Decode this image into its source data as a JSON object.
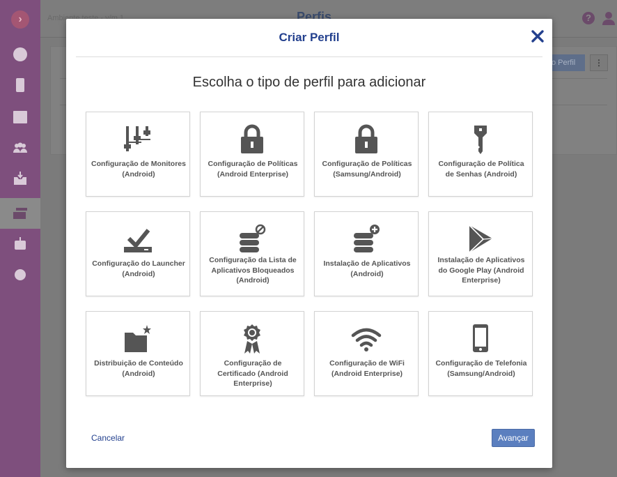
{
  "app": {
    "environment": "Ambiente teste - v/m 1",
    "page_title": "Perfis",
    "add_button_label": "o Perfil",
    "sidebar": [
      "dashboard-icon",
      "devices-icon",
      "table-icon",
      "groups-icon",
      "inbox-icon",
      "profiles-icon",
      "robot-icon",
      "gear-icon"
    ]
  },
  "modal": {
    "title": "Criar Perfil",
    "subtitle": "Escolha o tipo de perfil para adicionar",
    "cancel_label": "Cancelar",
    "next_label": "Avançar",
    "cards": [
      {
        "label": "Configuração de Monitores (Android)",
        "icon": "sliders-icon"
      },
      {
        "label": "Configuração de Políticas (Android Enterprise)",
        "icon": "lock-icon"
      },
      {
        "label": "Configuração de Políticas (Samsung/Android)",
        "icon": "lock-icon"
      },
      {
        "label": "Configuração de Política de Senhas (Android)",
        "icon": "key-icon"
      },
      {
        "label": "Configuração do Launcher (Android)",
        "icon": "check-tray-icon"
      },
      {
        "label": "Configuração da Lista de Aplicativos Bloqueados (Android)",
        "icon": "database-block-icon"
      },
      {
        "label": "Instalação de Aplicativos (Android)",
        "icon": "database-add-icon"
      },
      {
        "label": "Instalação de Aplicativos do Google Play (Android Enterprise)",
        "icon": "play-store-icon"
      },
      {
        "label": "Distribuição de Conteúdo (Android)",
        "icon": "folder-star-icon"
      },
      {
        "label": "Configuração de Certificado (Android Enterprise)",
        "icon": "certificate-icon"
      },
      {
        "label": "Configuração de WiFi (Android Enterprise)",
        "icon": "wifi-icon"
      },
      {
        "label": "Configuração de Telefonia (Samsung/Android)",
        "icon": "phone-icon"
      }
    ]
  },
  "colors": {
    "title": "#23408e",
    "icon": "#555555",
    "primary_button": "#5b7fbf",
    "sidebar": "#7e4f7d"
  }
}
